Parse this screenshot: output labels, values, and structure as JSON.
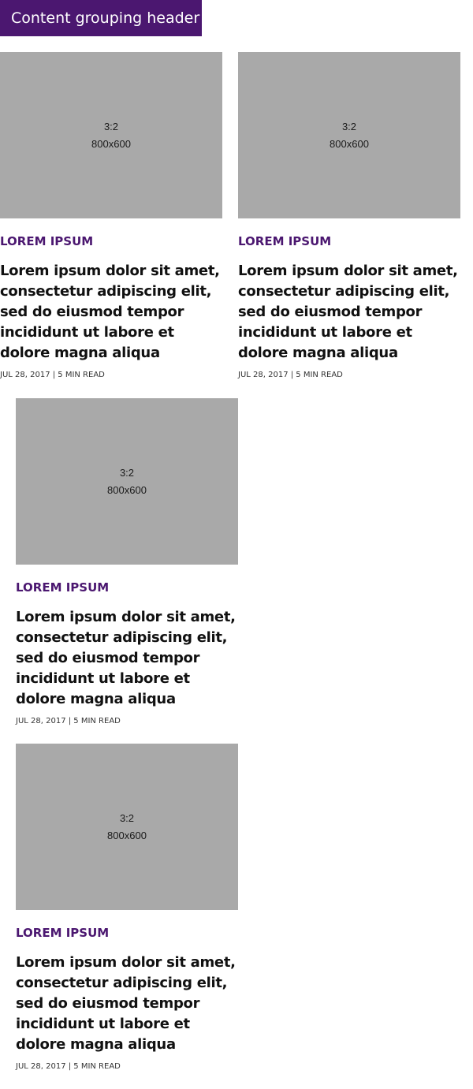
{
  "header": {
    "title": "Content grouping header"
  },
  "cards": [
    {
      "image_ratio": "3:2",
      "image_size": "800x600",
      "category": "LOREM IPSUM",
      "headline": "Lorem ipsum dolor sit amet, consectetur adipiscing elit, sed do eiusmod tempor incididunt ut labore et dolore magna aliqua",
      "meta": "JUL 28, 2017 | 5 MIN READ"
    },
    {
      "image_ratio": "3:2",
      "image_size": "800x600",
      "category": "LOREM IPSUM",
      "headline": "Lorem ipsum dolor sit amet, consectetur adipiscing elit, sed do eiusmod tempor incididunt ut labore et dolore magna aliqua",
      "meta": "JUL 28, 2017 | 5 MIN READ"
    },
    {
      "image_ratio": "3:2",
      "image_size": "800x600",
      "category": "LOREM IPSUM",
      "headline": "Lorem ipsum dolor sit amet, consectetur adipiscing elit, sed do eiusmod tempor incididunt ut labore et dolore magna aliqua",
      "meta": "JUL 28, 2017 | 5 MIN READ"
    },
    {
      "image_ratio": "3:2",
      "image_size": "800x600",
      "category": "LOREM IPSUM",
      "headline": "Lorem ipsum dolor sit amet, consectetur adipiscing elit, sed do eiusmod tempor incididunt ut labore et dolore magna aliqua",
      "meta": "JUL 28, 2017 | 5 MIN READ"
    }
  ],
  "colors": {
    "accent": "#4b1770",
    "placeholder": "#a9a9a9"
  }
}
